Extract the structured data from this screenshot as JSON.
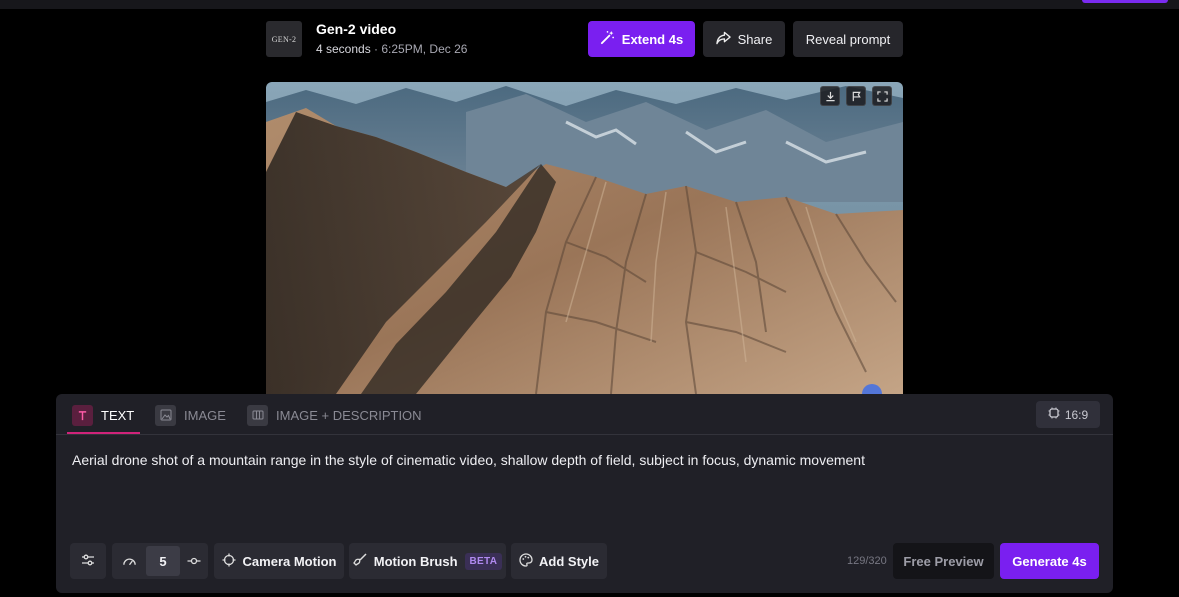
{
  "header": {
    "thumbnail_label": "GEN-2",
    "title": "Gen-2 video",
    "duration": "4 seconds",
    "separator": " · ",
    "timestamp": "6:25PM, Dec 26",
    "extend_label": "Extend 4s",
    "share_label": "Share",
    "reveal_label": "Reveal prompt"
  },
  "video": {
    "controls": [
      "download-icon",
      "flag-icon",
      "fullscreen-icon"
    ]
  },
  "panel": {
    "tabs": [
      {
        "label": "TEXT",
        "icon": "text-icon",
        "active": true
      },
      {
        "label": "IMAGE",
        "icon": "image-icon",
        "active": false
      },
      {
        "label": "IMAGE + DESCRIPTION",
        "icon": "image-description-icon",
        "active": false
      }
    ],
    "aspect_ratio": "16:9",
    "prompt": "Aerial drone shot of a mountain range in the style of cinematic video, shallow depth of field, subject in focus, dynamic movement",
    "speed_value": "5",
    "camera_motion_label": "Camera Motion",
    "motion_brush_label": "Motion Brush",
    "beta_label": "BETA",
    "add_style_label": "Add Style",
    "char_count": "129/320",
    "free_preview_label": "Free Preview",
    "generate_label": "Generate 4s"
  },
  "colors": {
    "accent": "#7a1ff0",
    "tab_active_underline": "#d0237a",
    "panel_bg": "#202027",
    "beta_text": "#b08af0"
  }
}
